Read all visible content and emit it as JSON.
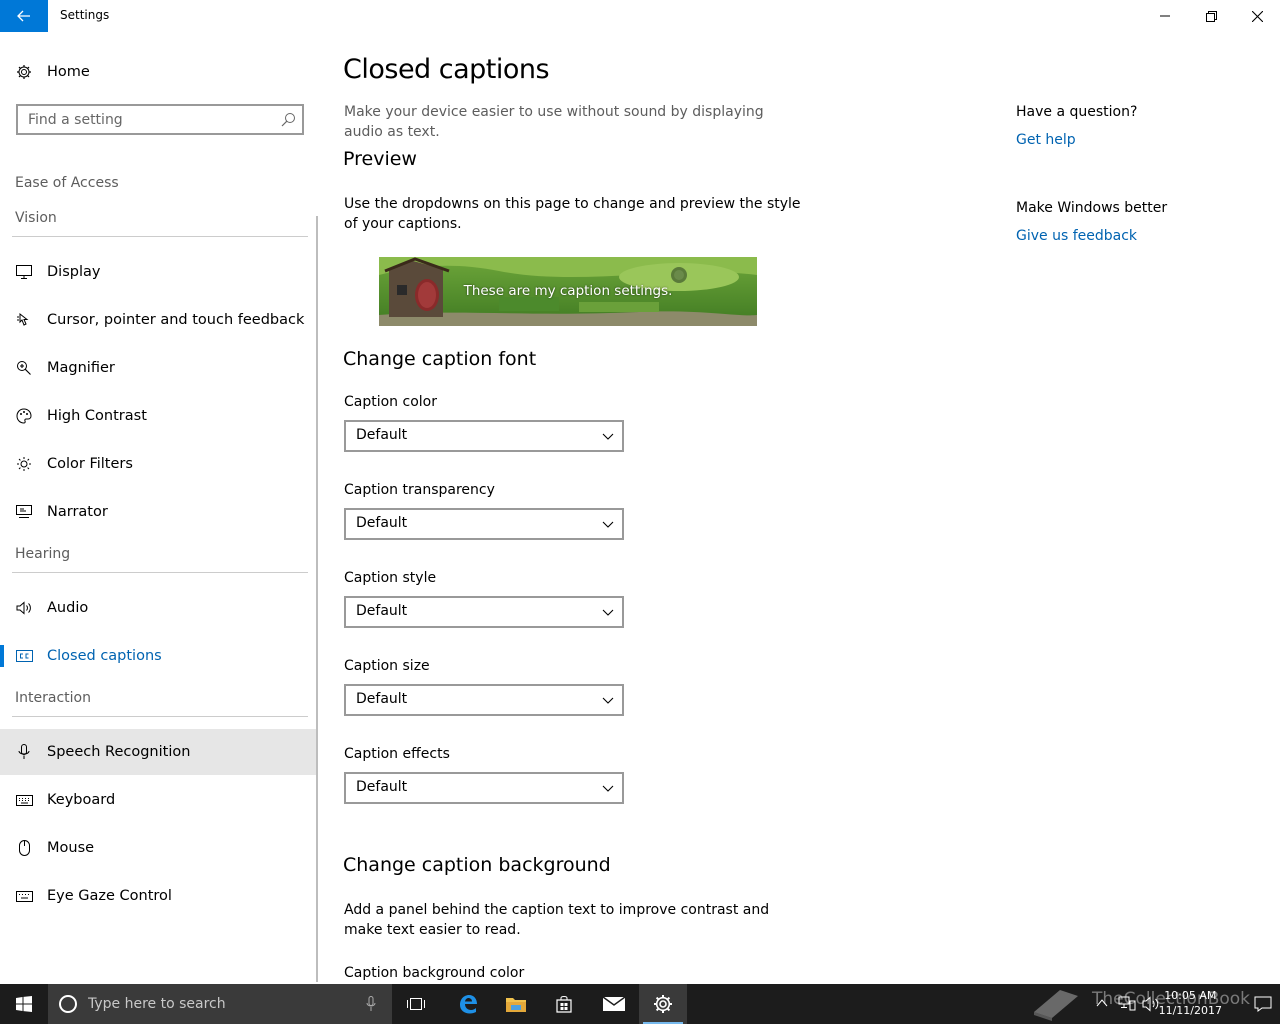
{
  "window": {
    "title": "Settings",
    "accent": "#0078d7"
  },
  "sidebar": {
    "home_label": "Home",
    "search_placeholder": "Find a setting",
    "category": "Ease of Access",
    "groups": {
      "vision": "Vision",
      "hearing": "Hearing",
      "interaction": "Interaction"
    },
    "items": {
      "display": "Display",
      "cursor": "Cursor, pointer and touch feedback",
      "magnifier": "Magnifier",
      "high_contrast": "High Contrast",
      "color_filters": "Color Filters",
      "narrator": "Narrator",
      "audio": "Audio",
      "closed_captions": "Closed captions",
      "speech": "Speech Recognition",
      "keyboard": "Keyboard",
      "mouse": "Mouse",
      "eye_gaze": "Eye Gaze Control"
    },
    "selected_item": "closed_captions"
  },
  "main": {
    "title": "Closed captions",
    "intro": "Make your device easier to use without sound by displaying audio as text.",
    "preview_title": "Preview",
    "preview_desc": "Use the dropdowns on this page to change and preview the style of your captions.",
    "preview_caption": "These are my caption settings.",
    "font_section": "Change caption font",
    "fields": {
      "color": {
        "label": "Caption color",
        "value": "Default"
      },
      "transparency": {
        "label": "Caption transparency",
        "value": "Default"
      },
      "style": {
        "label": "Caption style",
        "value": "Default"
      },
      "size": {
        "label": "Caption size",
        "value": "Default"
      },
      "effects": {
        "label": "Caption effects",
        "value": "Default"
      }
    },
    "background_section": "Change caption background",
    "background_desc": "Add a panel behind the caption text to improve contrast and make text easier to read.",
    "background_color_label": "Caption background color"
  },
  "help": {
    "question": "Have a question?",
    "get_help": "Get help",
    "better": "Make Windows better",
    "feedback": "Give us feedback"
  },
  "taskbar": {
    "search_placeholder": "Type here to search",
    "time": "10:05 AM",
    "date": "11/11/2017",
    "watermark": "TheCollectionBook"
  }
}
